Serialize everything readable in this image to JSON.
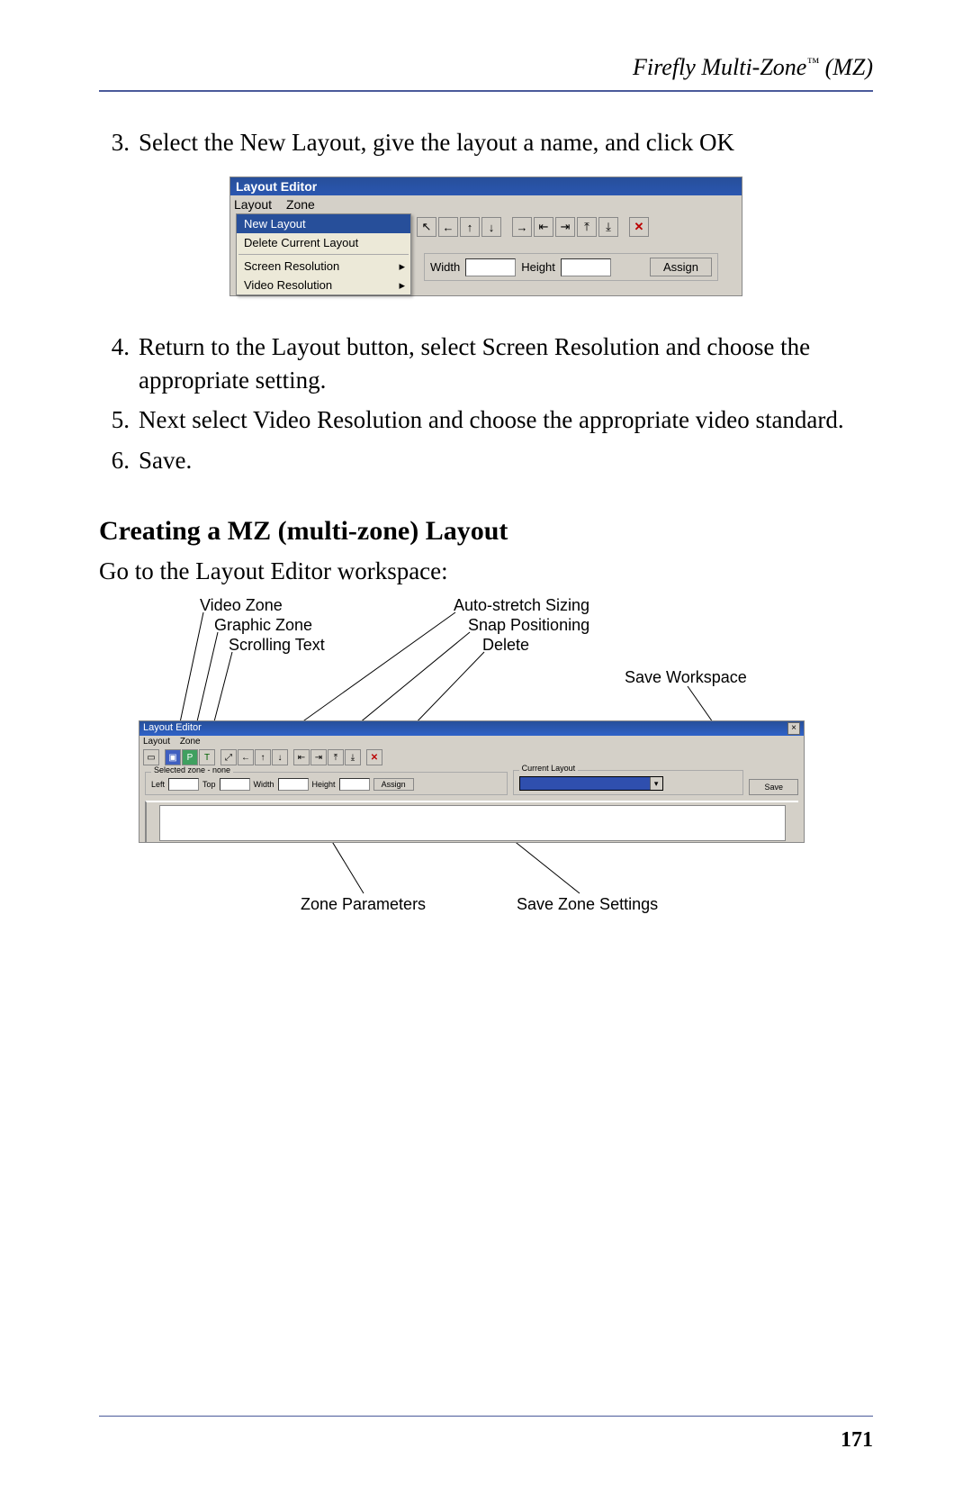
{
  "header": {
    "title_pre": "Firefly Multi-Zone",
    "title_tm": "™",
    "title_post": " (MZ)"
  },
  "steps": {
    "s3_num": "3.",
    "s3": "Select the New Layout, give the layout a name, and click OK",
    "s4_num": "4.",
    "s4": "Return to the Layout button, select Screen Resolution and choose the appropriate setting.",
    "s5_num": "5.",
    "s5": "Next select Video Resolution and choose the appropriate video standard.",
    "s6_num": "6.",
    "s6": "Save."
  },
  "shot1": {
    "title": "Layout Editor",
    "menu_layout": "Layout",
    "menu_zone": "Zone",
    "dd_new": "New Layout",
    "dd_delete": "Delete Current Layout",
    "dd_screen": "Screen Resolution",
    "dd_video": "Video Resolution",
    "width_label": "Width",
    "height_label": "Height",
    "assign": "Assign"
  },
  "section": {
    "heading": "Creating a MZ (multi-zone) Layout",
    "intro": "Go to the Layout Editor workspace:"
  },
  "ann": {
    "video_zone": "Video Zone",
    "graphic_zone": "Graphic Zone",
    "scrolling_text": "Scrolling Text",
    "auto_stretch": "Auto-stretch Sizing",
    "snap": "Snap Positioning",
    "delete": "Delete",
    "save_workspace": "Save Workspace",
    "zone_params": "Zone Parameters",
    "save_zone": "Save Zone Settings"
  },
  "shot2": {
    "title": "Layout Editor",
    "menu_layout": "Layout",
    "menu_zone": "Zone",
    "sel_zone_legend": "Selected zone - none",
    "left": "Left",
    "top": "Top",
    "width": "Width",
    "height": "Height",
    "assign": "Assign",
    "current_layout_legend": "Current Layout",
    "save": "Save"
  },
  "footer": {
    "page": "171"
  }
}
